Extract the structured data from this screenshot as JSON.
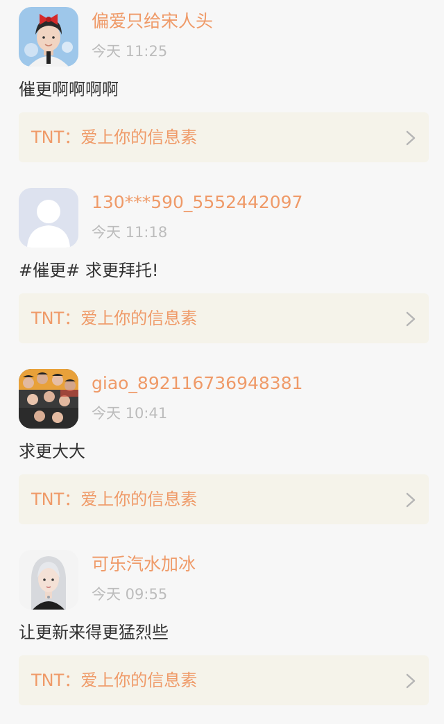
{
  "comments": [
    {
      "username": "偏爱只给宋人头",
      "time": "今天 11:25",
      "text": "催更啊啊啊啊",
      "source": "TNT：爱上你的信息素",
      "avatar_icon": "boy-with-red-bow-avatar"
    },
    {
      "username": "130***590_5552442097",
      "time": "今天 11:18",
      "text": "#催更# 求更拜托!",
      "source": "TNT：爱上你的信息素",
      "avatar_icon": "default-user-avatar"
    },
    {
      "username": "giao_892116736948381",
      "time": "今天 10:41",
      "text": "求更大大",
      "source": "TNT：爱上你的信息素",
      "avatar_icon": "group-photo-avatar"
    },
    {
      "username": "可乐汽水加冰",
      "time": "今天 09:55",
      "text": "让更新来得更猛烈些",
      "source": "TNT：爱上你的信息素",
      "avatar_icon": "silver-hair-girl-avatar"
    }
  ],
  "colors": {
    "accent": "#ef9a68",
    "timestamp": "#bcbcbc",
    "body_text": "#333333",
    "card_bg": "#f5f3ea",
    "page_bg": "#f7f7f7"
  }
}
